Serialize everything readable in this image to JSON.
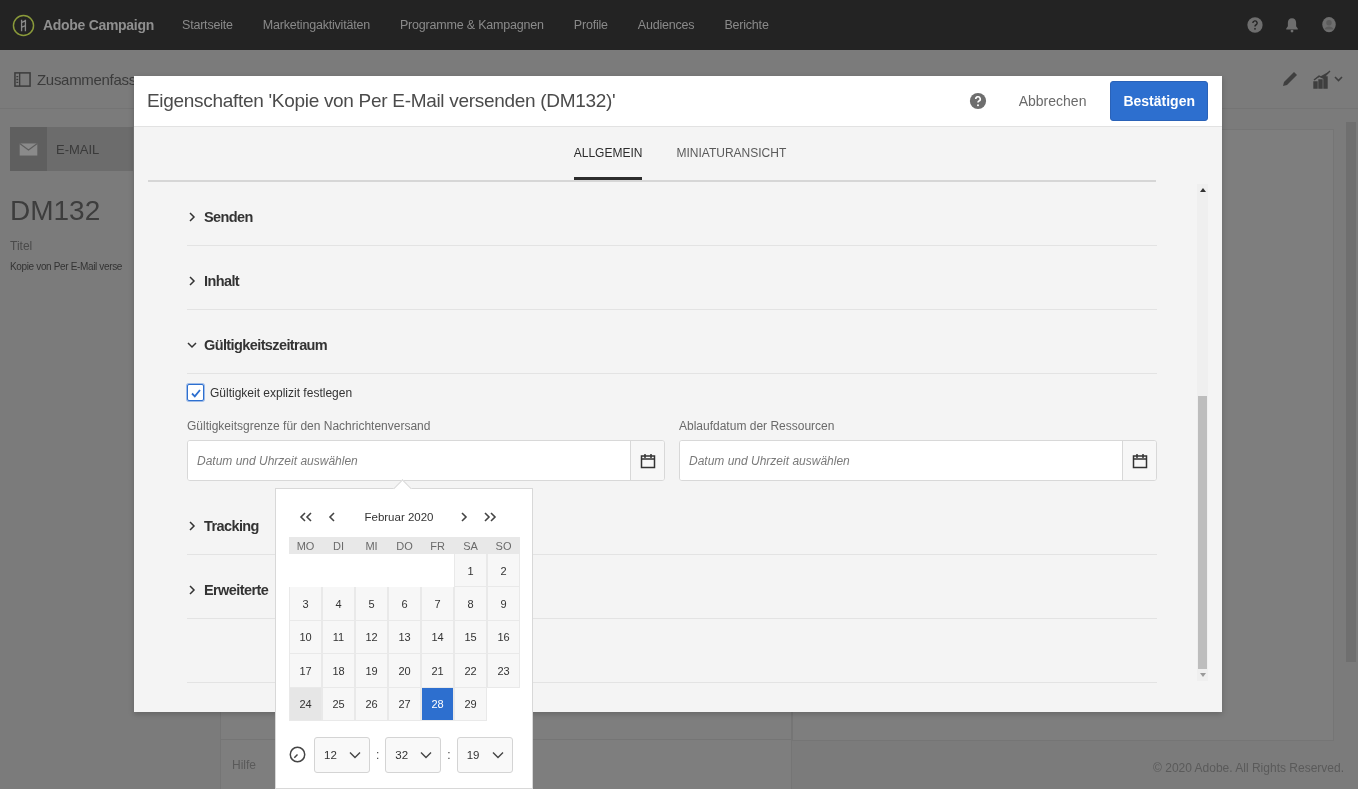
{
  "topbar": {
    "brand": "Adobe Campaign",
    "nav": [
      {
        "label": "Startseite"
      },
      {
        "label": "Marketingaktivitäten"
      },
      {
        "label": "Programme & Kampagnen"
      },
      {
        "label": "Profile"
      },
      {
        "label": "Audiences"
      },
      {
        "label": "Berichte"
      }
    ]
  },
  "background_page": {
    "header_title": "Zusammenfass",
    "card_label": "E-MAIL",
    "code": "DM132",
    "field_label": "Titel",
    "field_value": "Kopie von Per E-Mail verse",
    "footer_link": "Hilfe",
    "copyright": "© 2020 Adobe. All Rights Reserved."
  },
  "dialog": {
    "title": "Eigenschaften 'Kopie von Per E-Mail versenden (DM132)'",
    "cancel": "Abbrechen",
    "confirm": "Bestätigen",
    "tabs": [
      {
        "label": "ALLGEMEIN",
        "selected": true
      },
      {
        "label": "MINIATURANSICHT",
        "selected": false
      }
    ],
    "sections": [
      {
        "title": "Senden",
        "expanded": false
      },
      {
        "title": "Inhalt",
        "expanded": false
      },
      {
        "title": "Gültigkeitszeitraum",
        "expanded": true,
        "body": {
          "checkbox": {
            "label": "Gültigkeit explizit festlegen",
            "checked": true
          },
          "fields": [
            {
              "label": "Gültigkeitsgrenze für den Nachrichtenversand",
              "placeholder": "Datum und Uhrzeit auswählen"
            },
            {
              "label": "Ablaufdatum der Ressourcen",
              "placeholder": "Datum und Uhrzeit auswählen"
            }
          ]
        }
      },
      {
        "title": "Tracking",
        "expanded": false
      },
      {
        "title": "Erweiterte",
        "expanded": false
      }
    ]
  },
  "date_picker": {
    "month": "Februar 2020",
    "weekdays": [
      "MO",
      "DI",
      "MI",
      "DO",
      "FR",
      "SA",
      "SO"
    ],
    "weeks": [
      [
        {
          "kind": "blank"
        },
        {
          "kind": "blank"
        },
        {
          "kind": "blank"
        },
        {
          "kind": "blank"
        },
        {
          "kind": "blank"
        },
        {
          "kind": "day",
          "day": "1",
          "selected": false,
          "today": false
        },
        {
          "kind": "day",
          "day": "2",
          "selected": false,
          "today": false
        }
      ],
      [
        {
          "kind": "day",
          "day": "3",
          "selected": false,
          "today": false
        },
        {
          "kind": "day",
          "day": "4",
          "selected": false,
          "today": false
        },
        {
          "kind": "day",
          "day": "5",
          "selected": false,
          "today": false
        },
        {
          "kind": "day",
          "day": "6",
          "selected": false,
          "today": false
        },
        {
          "kind": "day",
          "day": "7",
          "selected": false,
          "today": false
        },
        {
          "kind": "day",
          "day": "8",
          "selected": false,
          "today": false
        },
        {
          "kind": "day",
          "day": "9",
          "selected": false,
          "today": false
        }
      ],
      [
        {
          "kind": "day",
          "day": "10",
          "selected": false,
          "today": false
        },
        {
          "kind": "day",
          "day": "11",
          "selected": false,
          "today": false
        },
        {
          "kind": "day",
          "day": "12",
          "selected": false,
          "today": false
        },
        {
          "kind": "day",
          "day": "13",
          "selected": false,
          "today": false
        },
        {
          "kind": "day",
          "day": "14",
          "selected": false,
          "today": false
        },
        {
          "kind": "day",
          "day": "15",
          "selected": false,
          "today": false
        },
        {
          "kind": "day",
          "day": "16",
          "selected": false,
          "today": false
        }
      ],
      [
        {
          "kind": "day",
          "day": "17",
          "selected": false,
          "today": false
        },
        {
          "kind": "day",
          "day": "18",
          "selected": false,
          "today": false
        },
        {
          "kind": "day",
          "day": "19",
          "selected": false,
          "today": false
        },
        {
          "kind": "day",
          "day": "20",
          "selected": false,
          "today": false
        },
        {
          "kind": "day",
          "day": "21",
          "selected": false,
          "today": false
        },
        {
          "kind": "day",
          "day": "22",
          "selected": false,
          "today": false
        },
        {
          "kind": "day",
          "day": "23",
          "selected": false,
          "today": false
        }
      ],
      [
        {
          "kind": "day",
          "day": "24",
          "selected": false,
          "today": true
        },
        {
          "kind": "day",
          "day": "25",
          "selected": false,
          "today": false
        },
        {
          "kind": "day",
          "day": "26",
          "selected": false,
          "today": false
        },
        {
          "kind": "day",
          "day": "27",
          "selected": false,
          "today": false
        },
        {
          "kind": "day",
          "day": "28",
          "selected": true,
          "today": false
        },
        {
          "kind": "day",
          "day": "29",
          "selected": false,
          "today": false
        }
      ]
    ],
    "time": {
      "hours": "12",
      "minutes": "32",
      "seconds": "19",
      "separators": [
        ":",
        ":"
      ]
    }
  }
}
